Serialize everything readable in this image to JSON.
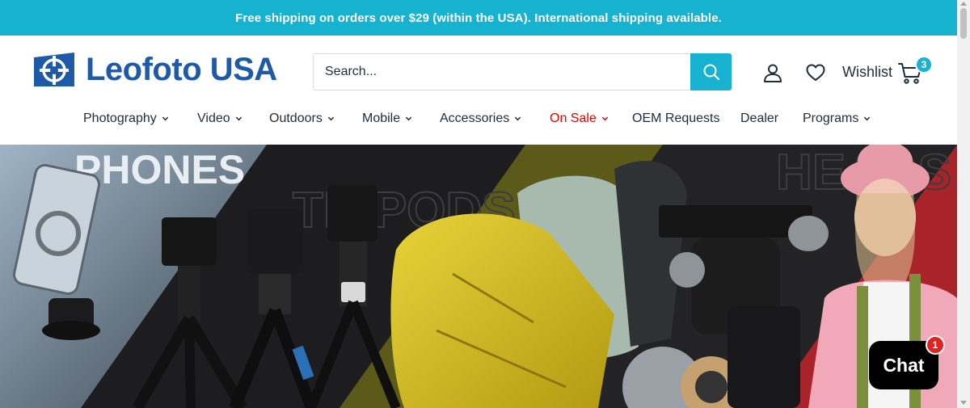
{
  "announcement": "Free shipping on orders over $29 (within the USA). International shipping available.",
  "logo": {
    "text": "Leofoto USA"
  },
  "search": {
    "placeholder": "Search..."
  },
  "header": {
    "wishlist_label": "Wishlist",
    "cart_count": "3"
  },
  "nav": [
    {
      "label": "Photography",
      "has_dropdown": true
    },
    {
      "label": "Video",
      "has_dropdown": true
    },
    {
      "label": "Outdoors",
      "has_dropdown": true
    },
    {
      "label": "Mobile",
      "has_dropdown": true
    },
    {
      "label": "Accessories",
      "has_dropdown": true
    },
    {
      "label": "On Sale",
      "has_dropdown": true
    },
    {
      "label": "OEM Requests",
      "has_dropdown": false
    },
    {
      "label": "Dealer",
      "has_dropdown": false
    },
    {
      "label": "Programs",
      "has_dropdown": true
    }
  ],
  "hero": {
    "words": [
      "PHONES",
      "TRIPODS",
      "HEADS"
    ]
  },
  "chat": {
    "label": "Chat",
    "badge": "1"
  },
  "colors": {
    "accent": "#16b2cf",
    "brand": "#1f5aa8",
    "sale": "#e60000"
  }
}
